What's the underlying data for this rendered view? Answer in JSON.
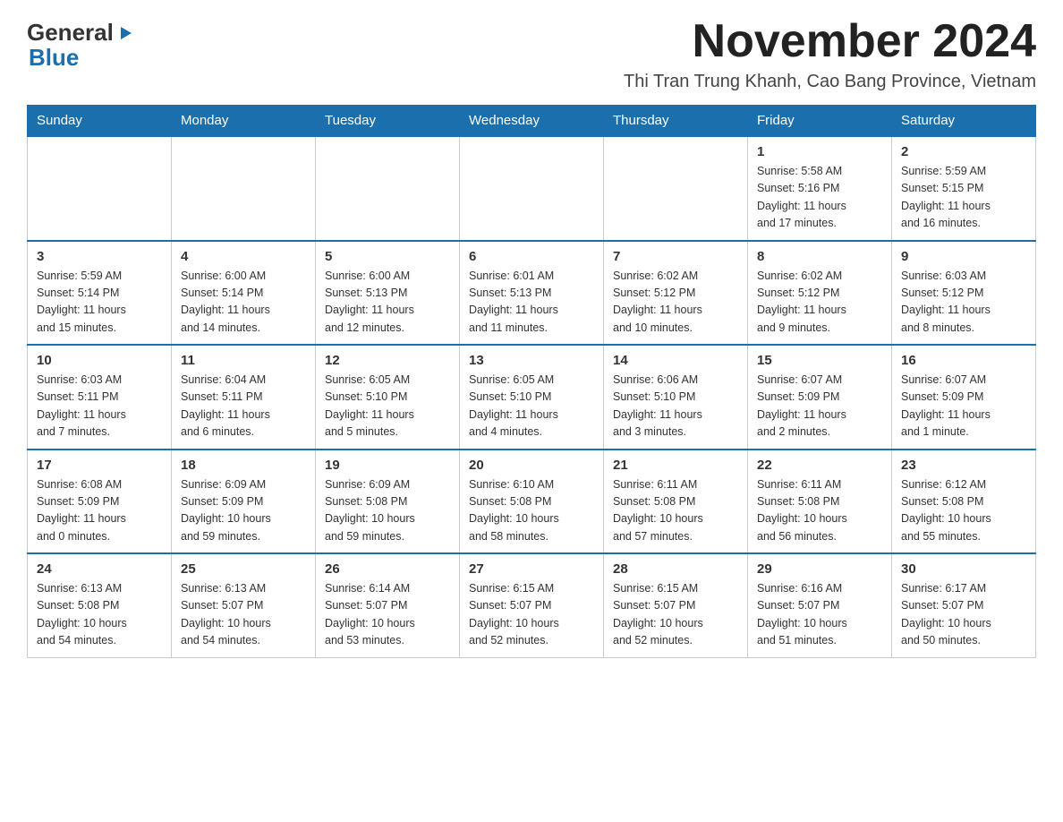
{
  "logo": {
    "general": "General",
    "blue": "Blue",
    "triangle_char": "▶"
  },
  "title": {
    "month_year": "November 2024",
    "location": "Thi Tran Trung Khanh, Cao Bang Province, Vietnam"
  },
  "days_of_week": [
    "Sunday",
    "Monday",
    "Tuesday",
    "Wednesday",
    "Thursday",
    "Friday",
    "Saturday"
  ],
  "weeks": [
    {
      "days": [
        {
          "number": "",
          "info": ""
        },
        {
          "number": "",
          "info": ""
        },
        {
          "number": "",
          "info": ""
        },
        {
          "number": "",
          "info": ""
        },
        {
          "number": "",
          "info": ""
        },
        {
          "number": "1",
          "info": "Sunrise: 5:58 AM\nSunset: 5:16 PM\nDaylight: 11 hours\nand 17 minutes."
        },
        {
          "number": "2",
          "info": "Sunrise: 5:59 AM\nSunset: 5:15 PM\nDaylight: 11 hours\nand 16 minutes."
        }
      ]
    },
    {
      "days": [
        {
          "number": "3",
          "info": "Sunrise: 5:59 AM\nSunset: 5:14 PM\nDaylight: 11 hours\nand 15 minutes."
        },
        {
          "number": "4",
          "info": "Sunrise: 6:00 AM\nSunset: 5:14 PM\nDaylight: 11 hours\nand 14 minutes."
        },
        {
          "number": "5",
          "info": "Sunrise: 6:00 AM\nSunset: 5:13 PM\nDaylight: 11 hours\nand 12 minutes."
        },
        {
          "number": "6",
          "info": "Sunrise: 6:01 AM\nSunset: 5:13 PM\nDaylight: 11 hours\nand 11 minutes."
        },
        {
          "number": "7",
          "info": "Sunrise: 6:02 AM\nSunset: 5:12 PM\nDaylight: 11 hours\nand 10 minutes."
        },
        {
          "number": "8",
          "info": "Sunrise: 6:02 AM\nSunset: 5:12 PM\nDaylight: 11 hours\nand 9 minutes."
        },
        {
          "number": "9",
          "info": "Sunrise: 6:03 AM\nSunset: 5:12 PM\nDaylight: 11 hours\nand 8 minutes."
        }
      ]
    },
    {
      "days": [
        {
          "number": "10",
          "info": "Sunrise: 6:03 AM\nSunset: 5:11 PM\nDaylight: 11 hours\nand 7 minutes."
        },
        {
          "number": "11",
          "info": "Sunrise: 6:04 AM\nSunset: 5:11 PM\nDaylight: 11 hours\nand 6 minutes."
        },
        {
          "number": "12",
          "info": "Sunrise: 6:05 AM\nSunset: 5:10 PM\nDaylight: 11 hours\nand 5 minutes."
        },
        {
          "number": "13",
          "info": "Sunrise: 6:05 AM\nSunset: 5:10 PM\nDaylight: 11 hours\nand 4 minutes."
        },
        {
          "number": "14",
          "info": "Sunrise: 6:06 AM\nSunset: 5:10 PM\nDaylight: 11 hours\nand 3 minutes."
        },
        {
          "number": "15",
          "info": "Sunrise: 6:07 AM\nSunset: 5:09 PM\nDaylight: 11 hours\nand 2 minutes."
        },
        {
          "number": "16",
          "info": "Sunrise: 6:07 AM\nSunset: 5:09 PM\nDaylight: 11 hours\nand 1 minute."
        }
      ]
    },
    {
      "days": [
        {
          "number": "17",
          "info": "Sunrise: 6:08 AM\nSunset: 5:09 PM\nDaylight: 11 hours\nand 0 minutes."
        },
        {
          "number": "18",
          "info": "Sunrise: 6:09 AM\nSunset: 5:09 PM\nDaylight: 10 hours\nand 59 minutes."
        },
        {
          "number": "19",
          "info": "Sunrise: 6:09 AM\nSunset: 5:08 PM\nDaylight: 10 hours\nand 59 minutes."
        },
        {
          "number": "20",
          "info": "Sunrise: 6:10 AM\nSunset: 5:08 PM\nDaylight: 10 hours\nand 58 minutes."
        },
        {
          "number": "21",
          "info": "Sunrise: 6:11 AM\nSunset: 5:08 PM\nDaylight: 10 hours\nand 57 minutes."
        },
        {
          "number": "22",
          "info": "Sunrise: 6:11 AM\nSunset: 5:08 PM\nDaylight: 10 hours\nand 56 minutes."
        },
        {
          "number": "23",
          "info": "Sunrise: 6:12 AM\nSunset: 5:08 PM\nDaylight: 10 hours\nand 55 minutes."
        }
      ]
    },
    {
      "days": [
        {
          "number": "24",
          "info": "Sunrise: 6:13 AM\nSunset: 5:08 PM\nDaylight: 10 hours\nand 54 minutes."
        },
        {
          "number": "25",
          "info": "Sunrise: 6:13 AM\nSunset: 5:07 PM\nDaylight: 10 hours\nand 54 minutes."
        },
        {
          "number": "26",
          "info": "Sunrise: 6:14 AM\nSunset: 5:07 PM\nDaylight: 10 hours\nand 53 minutes."
        },
        {
          "number": "27",
          "info": "Sunrise: 6:15 AM\nSunset: 5:07 PM\nDaylight: 10 hours\nand 52 minutes."
        },
        {
          "number": "28",
          "info": "Sunrise: 6:15 AM\nSunset: 5:07 PM\nDaylight: 10 hours\nand 52 minutes."
        },
        {
          "number": "29",
          "info": "Sunrise: 6:16 AM\nSunset: 5:07 PM\nDaylight: 10 hours\nand 51 minutes."
        },
        {
          "number": "30",
          "info": "Sunrise: 6:17 AM\nSunset: 5:07 PM\nDaylight: 10 hours\nand 50 minutes."
        }
      ]
    }
  ]
}
